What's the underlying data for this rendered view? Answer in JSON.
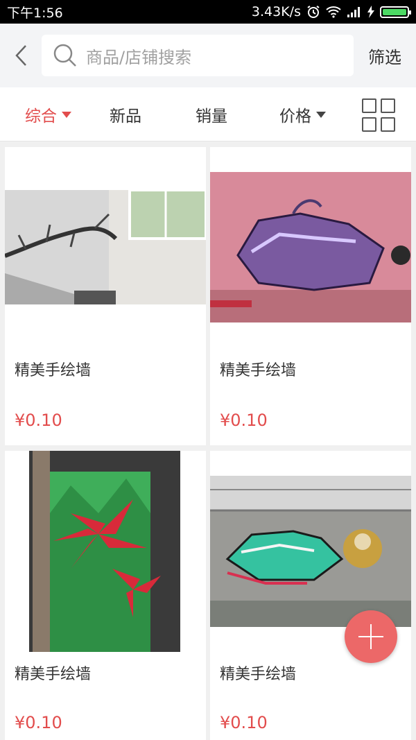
{
  "status": {
    "time": "下午1:56",
    "speed": "3.43K/s",
    "battery_level": 1.0
  },
  "header": {
    "search_placeholder": "商品/店铺搜索",
    "filter_label": "筛选"
  },
  "sort": [
    {
      "label": "综合",
      "active": true
    },
    {
      "label": "新品"
    },
    {
      "label": "销量"
    },
    {
      "label": "价格"
    }
  ],
  "products": [
    {
      "title": "精美手绘墙",
      "price": "¥0.10"
    },
    {
      "title": "精美手绘墙",
      "price": "¥0.10"
    },
    {
      "title": "精美手绘墙",
      "price": "¥0.10"
    },
    {
      "title": "精美手绘墙",
      "price": "¥0.10"
    }
  ],
  "colors": {
    "accent": "#e24c4c",
    "fab": "#ec6868"
  }
}
